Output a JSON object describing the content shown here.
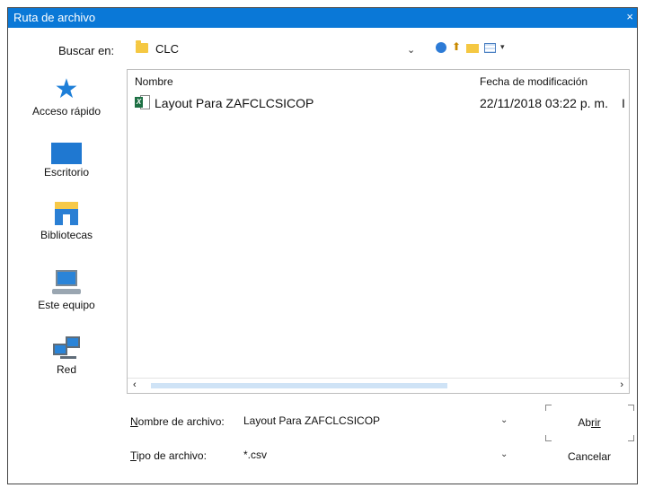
{
  "window": {
    "title": "Ruta de archivo",
    "close_symbol": "×",
    "accent_color": "#0a78d7"
  },
  "lookin": {
    "label": "Buscar en:",
    "value": "CLC",
    "dropdown_symbol": "⌄",
    "folder_icon": "folder-icon"
  },
  "toolbar": {
    "items": [
      "back-icon",
      "up-folder-icon",
      "new-folder-icon",
      "views-menu-icon"
    ]
  },
  "places": [
    {
      "label": "Acceso rápido",
      "icon": "star-icon"
    },
    {
      "label": "Escritorio",
      "icon": "desktop-icon"
    },
    {
      "label": "Bibliotecas",
      "icon": "libraries-icon"
    },
    {
      "label": "Este equipo",
      "icon": "computer-icon"
    },
    {
      "label": "Red",
      "icon": "network-icon"
    }
  ],
  "filelist": {
    "columns": {
      "name": "Nombre",
      "date": "Fecha de modificación"
    },
    "files": [
      {
        "name": "Layout Para  ZAFCLCSICOP",
        "date": "22/11/2018 03:22 p. m.",
        "extra": "I",
        "icon": "excel-file-icon"
      }
    ],
    "scroll_left": "‹",
    "scroll_right": "›"
  },
  "footer": {
    "filename_label_prefix": "N",
    "filename_label_rest": "ombre de archivo:",
    "filename_value": "Layout Para  ZAFCLCSICOP",
    "filetype_label_prefix": "T",
    "filetype_label_rest": "ipo de archivo:",
    "filetype_value": "*.csv",
    "open_prefix": "Ab",
    "open_rest": "rir",
    "cancel_label": "Cancelar",
    "dropdown_symbol": "⌄"
  }
}
